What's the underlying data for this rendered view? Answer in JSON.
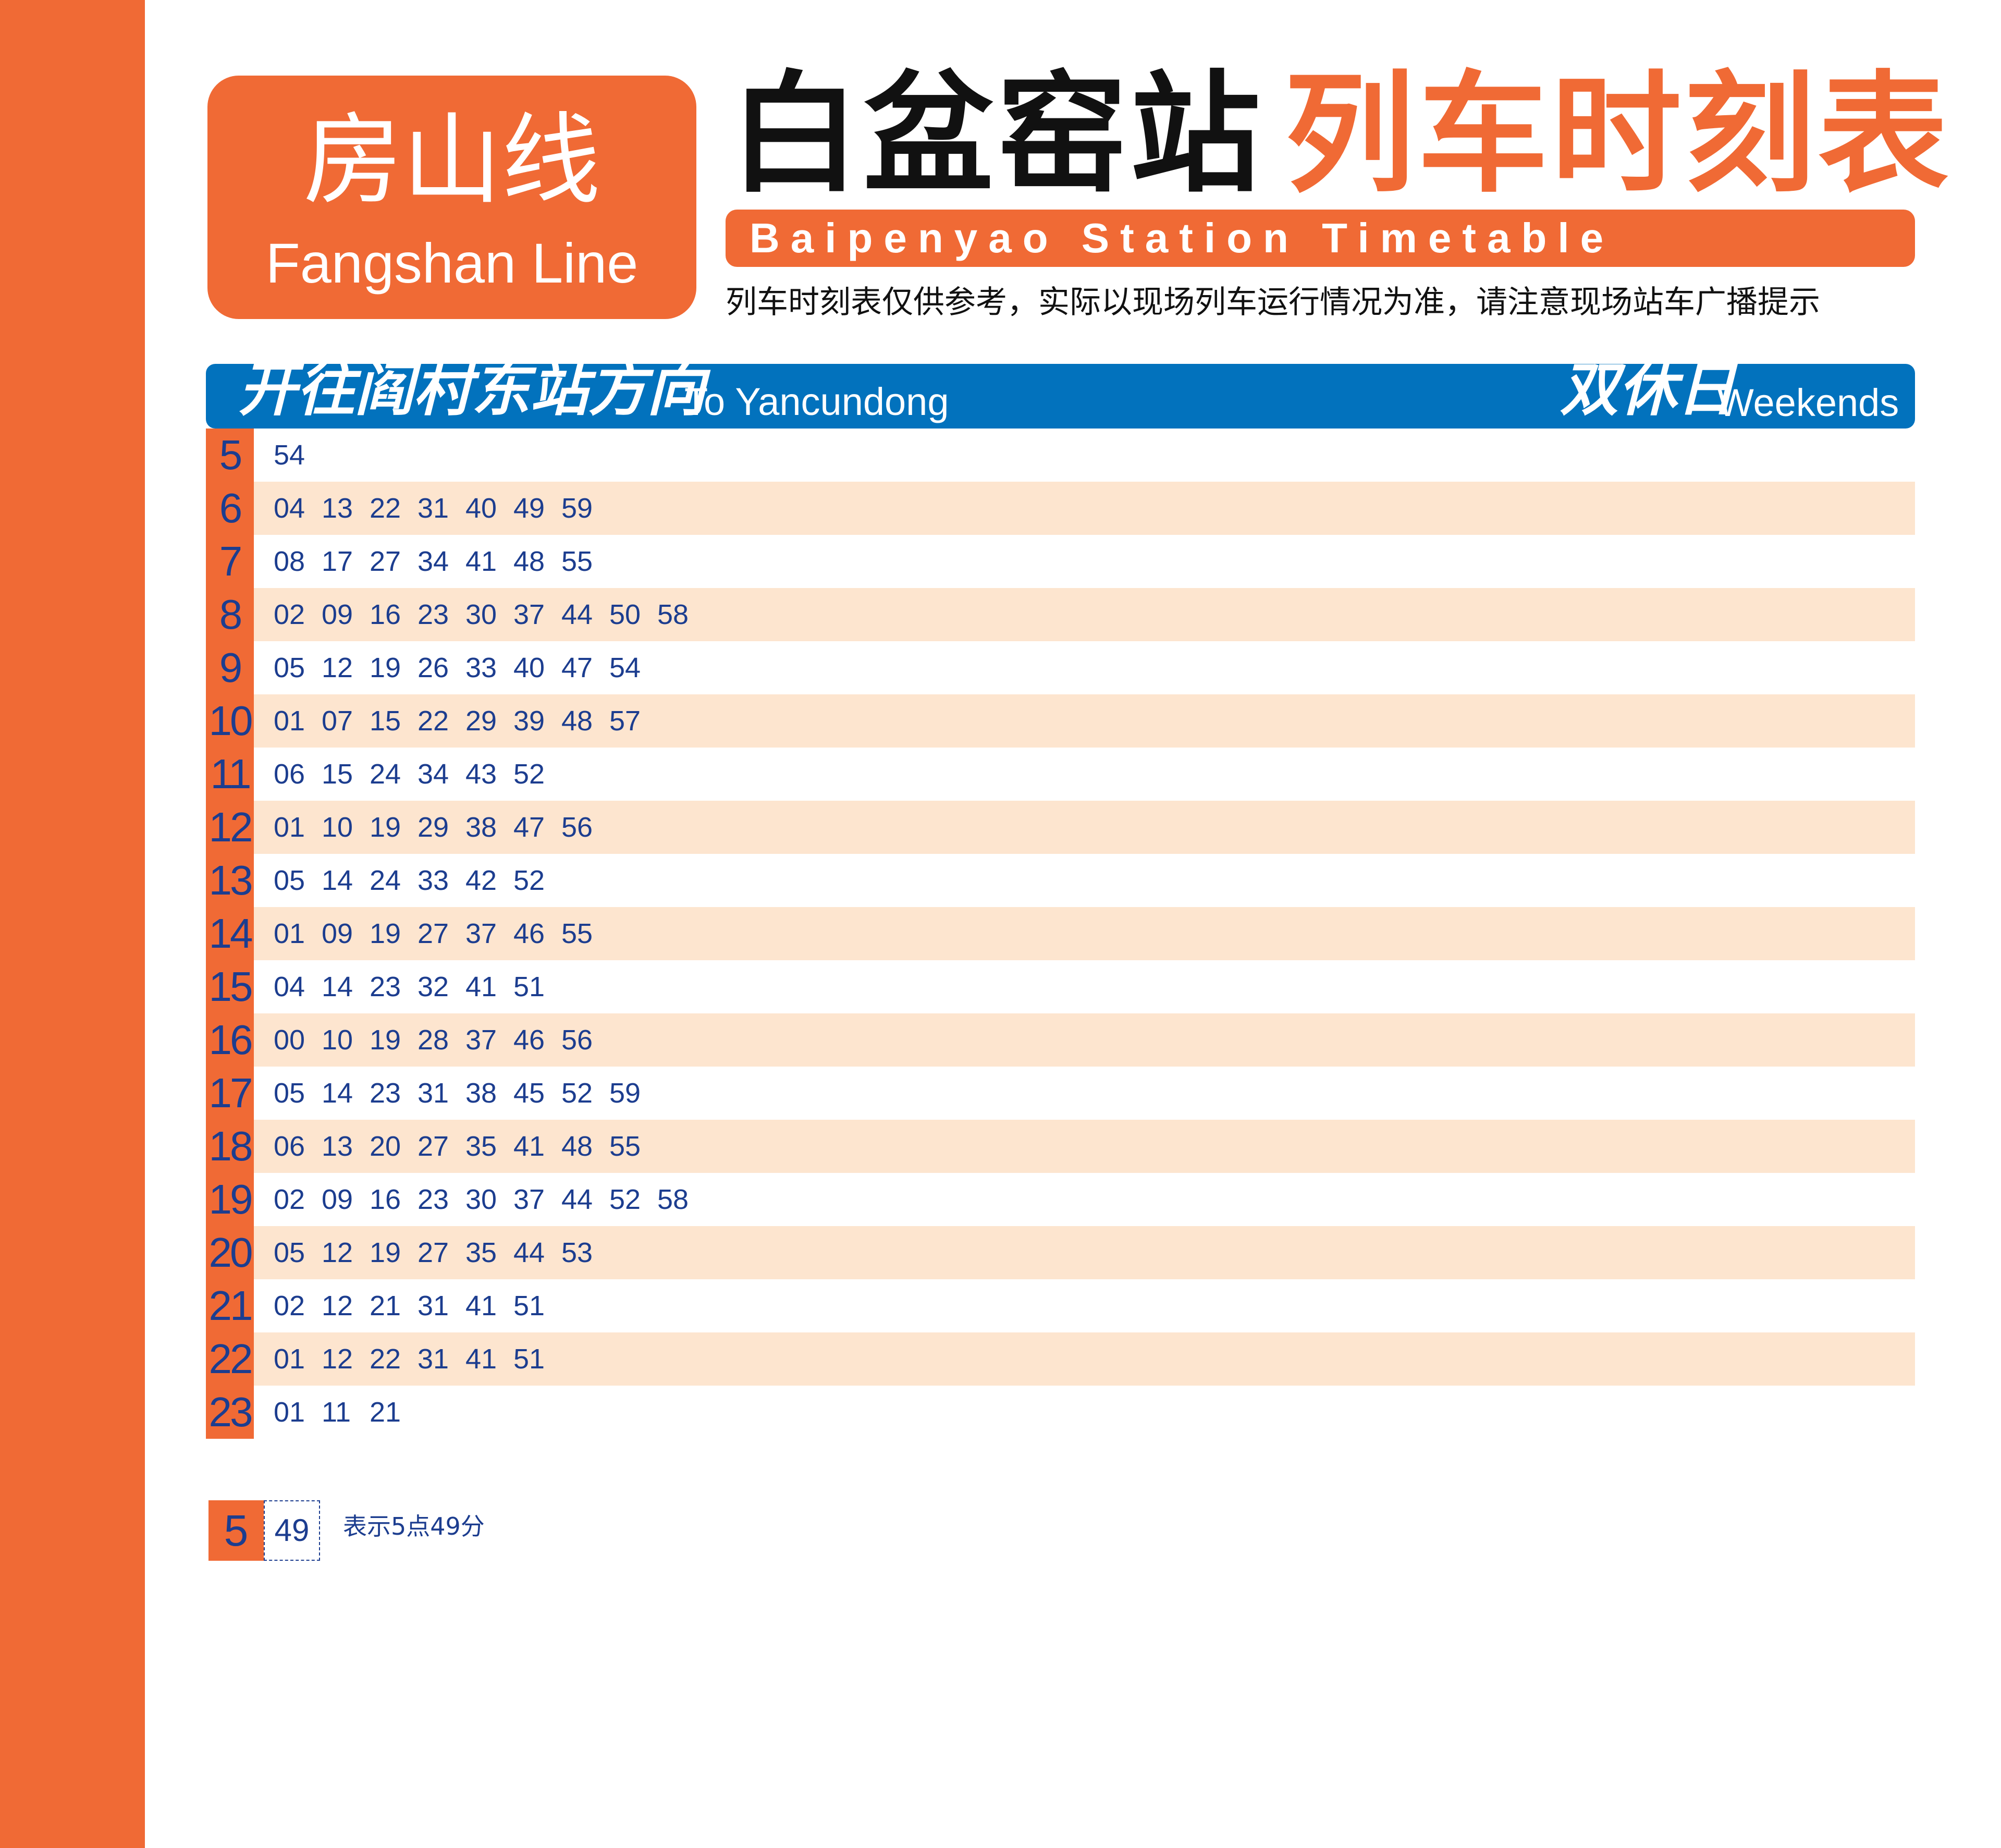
{
  "line": {
    "name_zh": "房山线",
    "name_en": "Fangshan Line"
  },
  "title": {
    "station_zh": "白盆窑站",
    "label_zh": "列车时刻表",
    "subtitle_en": "Baipenyao Station Timetable"
  },
  "notice": "列车时刻表仅供参考，实际以现场列车运行情况为准，请注意现场站车广播提示",
  "direction": {
    "zh": "开往阎村东站方向",
    "en": "To Yancundong",
    "day_zh": "双休日",
    "day_en": "Weekends"
  },
  "colors": {
    "accent": "#F06A35",
    "header_blue": "#0272BD",
    "row_alt": "#FDE5CF",
    "text_blue": "#1C3D8F"
  },
  "timetable": [
    {
      "hour": "5",
      "minutes": [
        "54"
      ]
    },
    {
      "hour": "6",
      "minutes": [
        "04",
        "13",
        "22",
        "31",
        "40",
        "49",
        "59"
      ]
    },
    {
      "hour": "7",
      "minutes": [
        "08",
        "17",
        "27",
        "34",
        "41",
        "48",
        "55"
      ]
    },
    {
      "hour": "8",
      "minutes": [
        "02",
        "09",
        "16",
        "23",
        "30",
        "37",
        "44",
        "50",
        "58"
      ]
    },
    {
      "hour": "9",
      "minutes": [
        "05",
        "12",
        "19",
        "26",
        "33",
        "40",
        "47",
        "54"
      ]
    },
    {
      "hour": "10",
      "minutes": [
        "01",
        "07",
        "15",
        "22",
        "29",
        "39",
        "48",
        "57"
      ]
    },
    {
      "hour": "11",
      "minutes": [
        "06",
        "15",
        "24",
        "34",
        "43",
        "52"
      ]
    },
    {
      "hour": "12",
      "minutes": [
        "01",
        "10",
        "19",
        "29",
        "38",
        "47",
        "56"
      ]
    },
    {
      "hour": "13",
      "minutes": [
        "05",
        "14",
        "24",
        "33",
        "42",
        "52"
      ]
    },
    {
      "hour": "14",
      "minutes": [
        "01",
        "09",
        "19",
        "27",
        "37",
        "46",
        "55"
      ]
    },
    {
      "hour": "15",
      "minutes": [
        "04",
        "14",
        "23",
        "32",
        "41",
        "51"
      ]
    },
    {
      "hour": "16",
      "minutes": [
        "00",
        "10",
        "19",
        "28",
        "37",
        "46",
        "56"
      ]
    },
    {
      "hour": "17",
      "minutes": [
        "05",
        "14",
        "23",
        "31",
        "38",
        "45",
        "52",
        "59"
      ]
    },
    {
      "hour": "18",
      "minutes": [
        "06",
        "13",
        "20",
        "27",
        "35",
        "41",
        "48",
        "55"
      ]
    },
    {
      "hour": "19",
      "minutes": [
        "02",
        "09",
        "16",
        "23",
        "30",
        "37",
        "44",
        "52",
        "58"
      ]
    },
    {
      "hour": "20",
      "minutes": [
        "05",
        "12",
        "19",
        "27",
        "35",
        "44",
        "53"
      ]
    },
    {
      "hour": "21",
      "minutes": [
        "02",
        "12",
        "21",
        "31",
        "41",
        "51"
      ]
    },
    {
      "hour": "22",
      "minutes": [
        "01",
        "12",
        "22",
        "31",
        "41",
        "51"
      ]
    },
    {
      "hour": "23",
      "minutes": [
        "01",
        "11",
        "21"
      ]
    }
  ],
  "legend": {
    "hour": "5",
    "minute": "49",
    "text": "表示5点49分"
  }
}
